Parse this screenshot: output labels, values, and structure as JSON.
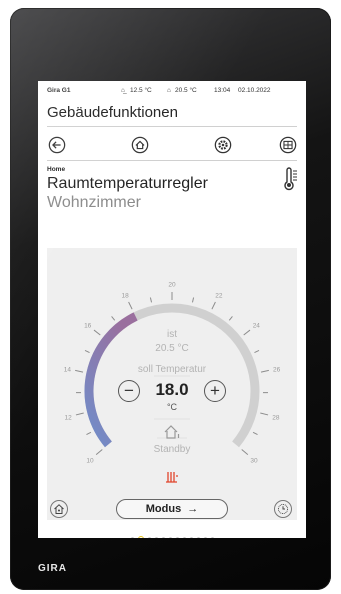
{
  "device": {
    "brand": "GIRA"
  },
  "statusbar": {
    "device_name": "Gira G1",
    "outdoor_temp": "12.5 °C",
    "indoor_temp": "20.5 °C",
    "time": "13:04",
    "date": "02.10.2022"
  },
  "title": "Gebäudefunktionen",
  "nav": {
    "back_icon": "back-arrow-icon",
    "home_icon": "home-icon",
    "settings_icon": "gear-icon",
    "grid_icon": "grid-icon"
  },
  "header": {
    "breadcrumb": "Home",
    "function": "Raumtemperaturregler",
    "room": "Wohnzimmer",
    "icon": "thermometer-icon"
  },
  "thermostat": {
    "ist_label": "ist",
    "ist_value": "20.5 °C",
    "soll_label": "soll Temperatur",
    "setpoint": "18.0",
    "unit": "°C",
    "minus_label": "−",
    "plus_label": "+",
    "mode_status": "Standby",
    "mode_icon": "home-standby-icon",
    "heating_icon": "heating-icon",
    "scale": {
      "min": 10,
      "max": 30,
      "labels": [
        "10",
        "12",
        "14",
        "16",
        "18",
        "20",
        "22",
        "24",
        "26",
        "28",
        "30"
      ]
    },
    "colors": {
      "cool": "#6f8ecb",
      "warm": "#9a6f9e",
      "arc": "#d0d0d0"
    }
  },
  "footer": {
    "modus_label": "Modus",
    "modus_arrow": "→",
    "left_icon": "home-settings-icon",
    "right_icon": "clock-icon"
  },
  "pager": {
    "count": 12,
    "active": 1
  }
}
